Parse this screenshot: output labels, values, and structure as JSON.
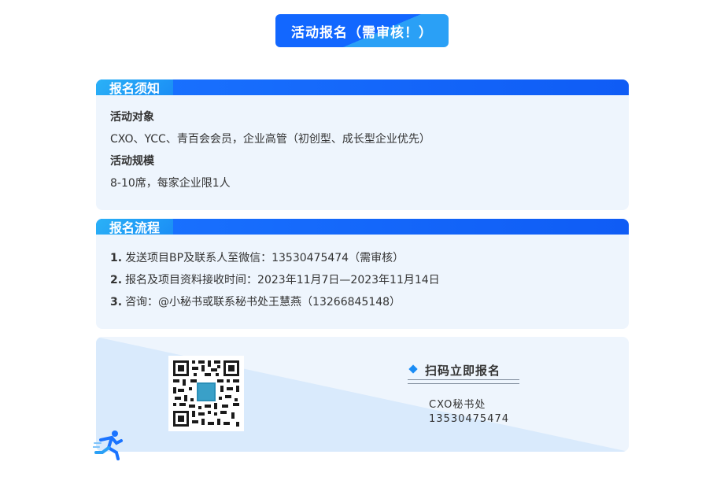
{
  "title": "活动报名（需审核！）",
  "section1": {
    "tab": "报名须知",
    "target_label": "活动对象",
    "target_text": "CXO、YCC、青百会会员，企业高管（初创型、成长型企业优先）",
    "scale_label": "活动规模",
    "scale_text": "8-10席，每家企业限1人"
  },
  "section2": {
    "tab": "报名流程",
    "steps": [
      {
        "num": "1.",
        "text": "发送项目BP及联系人至微信：13530475474（需审核）"
      },
      {
        "num": "2.",
        "text": "报名及项目资料接收时间：2023年11月7日—2023年11月14日"
      },
      {
        "num": "3.",
        "text": "咨询：@小秘书或联系秘书处王慧燕（13266845148）"
      }
    ]
  },
  "qr": {
    "label": "扫码立即报名",
    "contact_name": "CXO秘书处",
    "contact_phone": "13530475474"
  },
  "colors": {
    "primary": "#1267ff",
    "accent": "#2aa0f6",
    "panel_bg": "#eef5fd"
  }
}
